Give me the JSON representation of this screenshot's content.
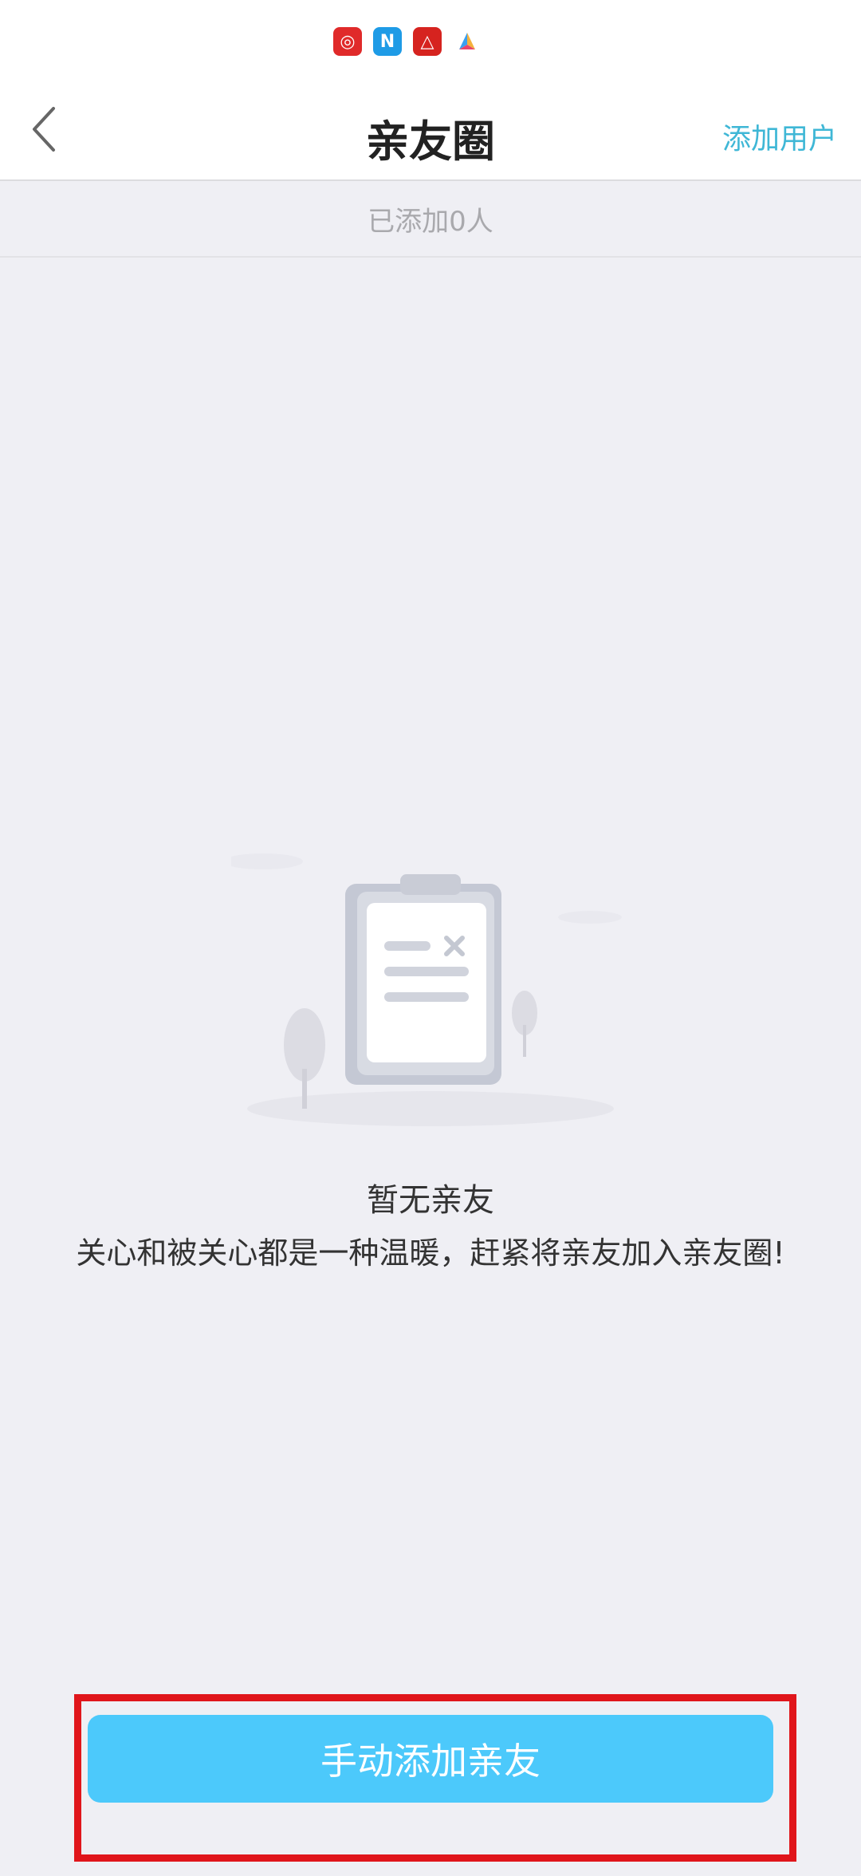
{
  "status_bar": {
    "icons": [
      "netease-music-icon",
      "n-app-icon",
      "triangle-app-icon",
      "colorful-a-icon"
    ],
    "icon_glyphs": [
      "◎",
      "N",
      "△",
      "▲"
    ]
  },
  "nav": {
    "title": "亲友圈",
    "add_user_label": "添加用户"
  },
  "count_text": "已添加0人",
  "empty": {
    "title": "暂无亲友",
    "description": "关心和被关心都是一种温暖，赶紧将亲友加入亲友圈!"
  },
  "bottom_button_label": "手动添加亲友",
  "colors": {
    "accent": "#4cc9fb",
    "link": "#3fb7d6",
    "highlight": "#e0151b",
    "background": "#efeff4"
  }
}
